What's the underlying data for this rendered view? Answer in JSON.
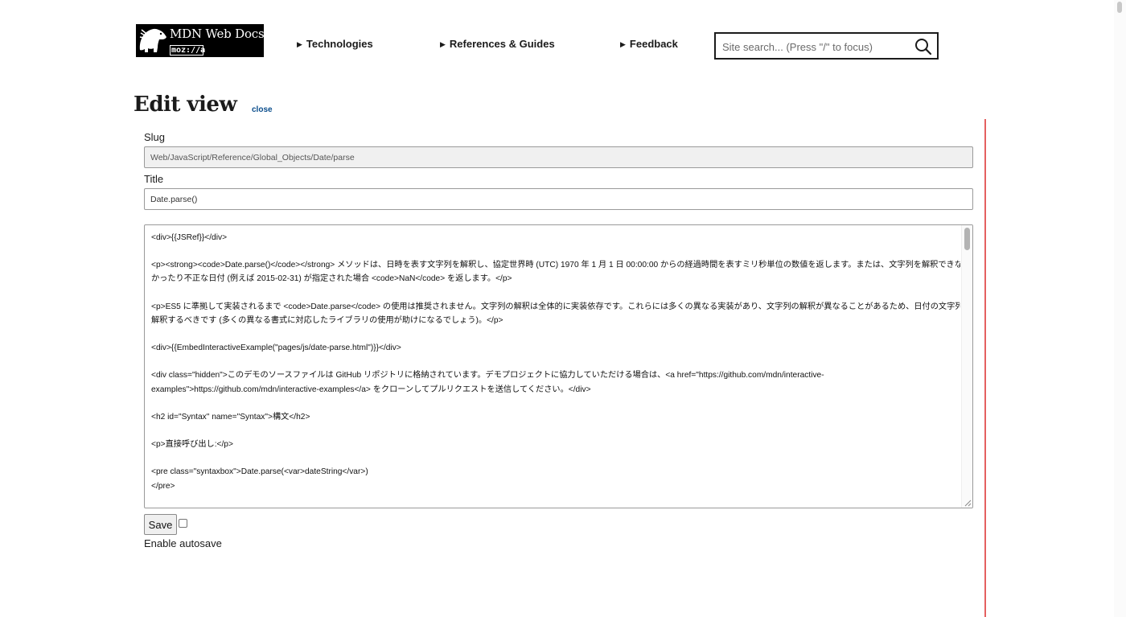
{
  "header": {
    "logo_text": "MDN Web Docs",
    "logo_sub": "moz://a",
    "nav": [
      {
        "label": "Technologies"
      },
      {
        "label": "References & Guides"
      },
      {
        "label": "Feedback"
      }
    ],
    "search_placeholder": "Site search... (Press \"/\" to focus)"
  },
  "page": {
    "title": "Edit view",
    "close_label": "close"
  },
  "form": {
    "slug_label": "Slug",
    "slug_value": "Web/JavaScript/Reference/Global_Objects/Date/parse",
    "title_label": "Title",
    "title_value": "Date.parse()",
    "content_lines": [
      "<div>{{JSRef}}</div>",
      "",
      "<p><strong><code>Date.parse()</code></strong> メソッドは、日時を表す文字列を解釈し、協定世界時 (UTC) 1970 年 1 月 1 日 00:00:00 からの経過時間を表すミリ秒単位の数値を返します。または、文字列を解釈できな",
      "かったり不正な日付 (例えば 2015-02-31) が指定された場合 <code>NaN</code> を返します。</p>",
      "",
      "<p>ES5 に準拠して実装されるまで <code>Date.parse</code> の使用は推奨されません。文字列の解釈は全体的に実装依存です。これらには多くの異なる実装があり、文字列の解釈が異なることがあるため、日付の文字列は手動で",
      "解釈するべきです (多くの異なる書式に対応したライブラリの使用が助けになるでしょう)。</p>",
      "",
      "<div>{{EmbedInteractiveExample(\"pages/js/date-parse.html\")}}</div>",
      "",
      "<div class=\"hidden\">このデモのソースファイルは GitHub リポジトリに格納されています。デモプロジェクトに協力していただける場合は、<a href=\"https://github.com/mdn/interactive-",
      "examples\">https://github.com/mdn/interactive-examples</a> をクローンしてプルリクエストを送信してください。</div>",
      "",
      "<h2 id=\"Syntax\" name=\"Syntax\">構文</h2>",
      "",
      "<p>直接呼び出し:</p>",
      "",
      "<pre class=\"syntaxbox\">Date.parse(<var>dateString</var>)",
      "</pre>"
    ],
    "save_label": "Save",
    "autosave_label": "Enable autosave",
    "autosave_checked": false
  }
}
